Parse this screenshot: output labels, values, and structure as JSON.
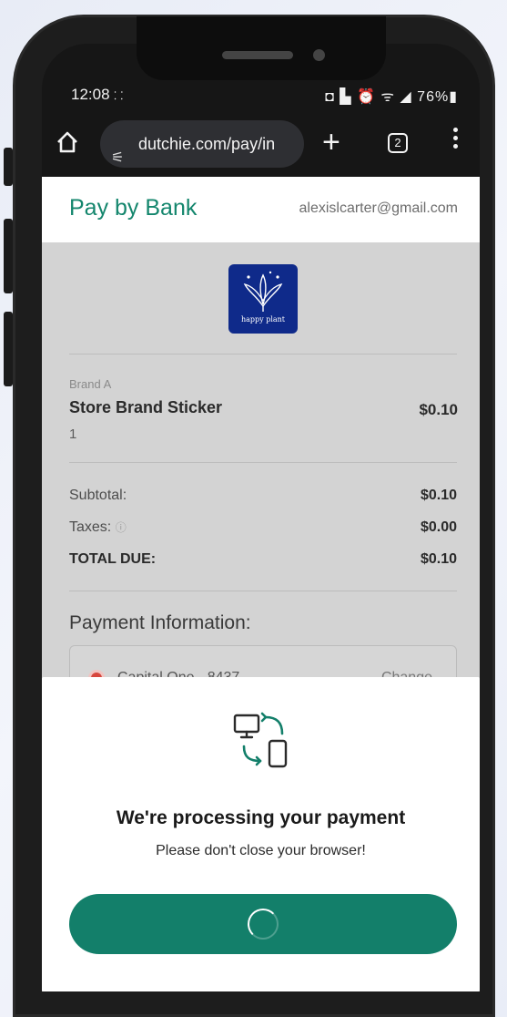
{
  "status_bar": {
    "time": "12:08",
    "time_extra": "⸬",
    "right_icons": "◘ ▙ ⏰ ᯤ ◢ 76%▮"
  },
  "browser": {
    "url": "dutchie.com/pay/in",
    "tab_count": "2"
  },
  "header": {
    "title": "Pay by Bank",
    "email": "alexislcarter@gmail.com"
  },
  "logo": {
    "text": "happy plant",
    "bg_color": "#0f2a8a"
  },
  "order": {
    "brand": "Brand A",
    "item_name": "Store Brand Sticker",
    "item_price": "$0.10",
    "item_qty": "1",
    "subtotal_label": "Subtotal:",
    "subtotal_value": "$0.10",
    "taxes_label": "Taxes:",
    "taxes_value": "$0.00",
    "total_label": "TOTAL DUE:",
    "total_value": "$0.10"
  },
  "payment": {
    "title": "Payment Information:",
    "bank": "Capital One - 8437",
    "change_label": "Change"
  },
  "processing": {
    "title": "We're processing your payment",
    "subtitle": "Please don't close your browser!",
    "accent": "#137f6a"
  }
}
